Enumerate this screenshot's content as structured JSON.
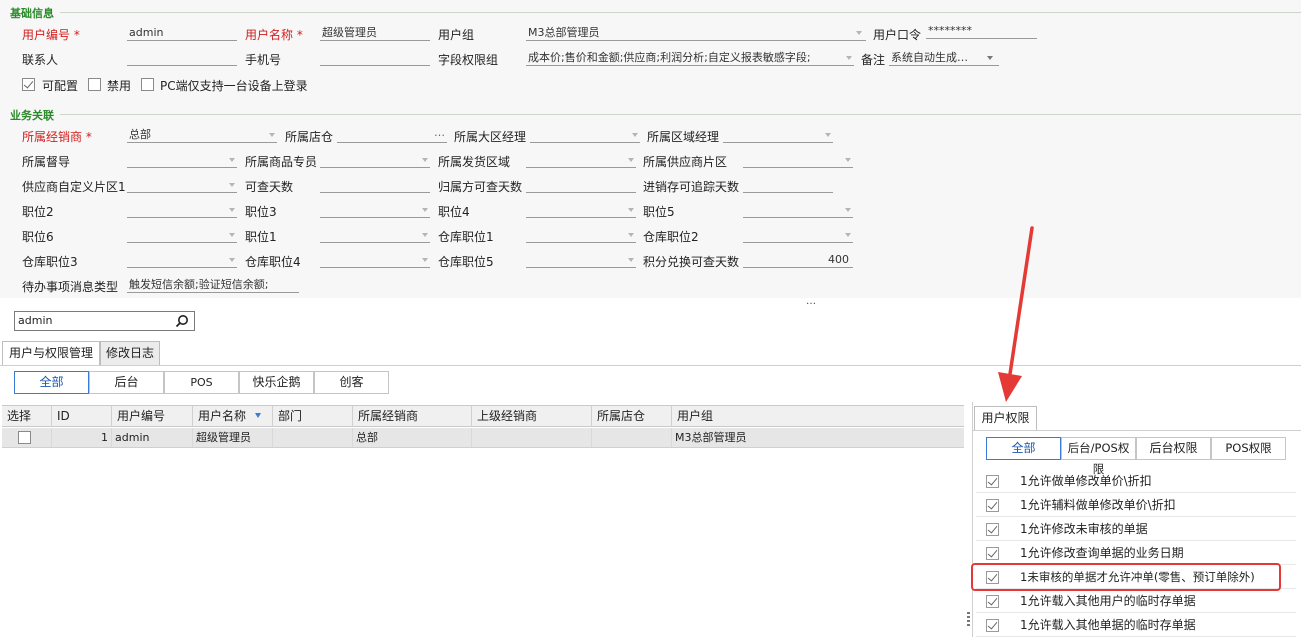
{
  "basic": {
    "title": "基础信息",
    "user_code_label": "用户编号",
    "user_code_value": "admin",
    "user_name_label": "用户名称",
    "user_name_value": "超级管理员",
    "user_group_label": "用户组",
    "user_group_value": "M3总部管理员",
    "password_label": "用户口令",
    "password_value": "********",
    "contact_label": "联系人",
    "phone_label": "手机号",
    "field_perm_label": "字段权限组",
    "field_perm_value": "成本价;售价和金额;供应商;利润分析;自定义报表敏感字段;",
    "remark_label": "备注",
    "remark_value": "系统自动生成…",
    "asterisk": "*",
    "chk_configurable": "可配置",
    "chk_disabled": "禁用",
    "chk_pc_single": "PC端仅支持一台设备上登录"
  },
  "biz": {
    "title": "业务关联",
    "dealer_label": "所属经销商",
    "dealer_value": "总部",
    "store_label": "所属店仓",
    "store_value": "…",
    "region_mgr_label": "所属大区经理",
    "area_mgr_label": "所属区域经理",
    "supervisor_label": "所属督导",
    "goods_label": "所属商品专员",
    "ship_area_label": "所属发货区域",
    "supplier_area_label": "所属供应商片区",
    "supplier_custom_label": "供应商自定义片区1",
    "view_days_label": "可查天数",
    "owner_view_days_label": "归属方可查天数",
    "inv_trace_days_label": "进销存可追踪天数",
    "pos2_label": "职位2",
    "pos3_label": "职位3",
    "pos4_label": "职位4",
    "pos5_label": "职位5",
    "pos6_label": "职位6",
    "pos1_label": "职位1",
    "wh_pos1_label": "仓库职位1",
    "wh_pos2_label": "仓库职位2",
    "wh_pos3_label": "仓库职位3",
    "wh_pos4_label": "仓库职位4",
    "wh_pos5_label": "仓库职位5",
    "points_days_label": "积分兑换可查天数",
    "points_days_value": "400",
    "todo_label": "待办事项消息类型",
    "todo_value": "触发短信余额;验证短信余额;",
    "more": "…"
  },
  "search": {
    "value": "admin"
  },
  "tabs": [
    "用户与权限管理",
    "修改日志"
  ],
  "filters": [
    "全部",
    "后台",
    "POS",
    "快乐企鹅",
    "创客"
  ],
  "grid": {
    "headers": [
      "选择",
      "ID",
      "用户编号",
      "用户名称",
      "部门",
      "所属经销商",
      "上级经销商",
      "所属店仓",
      "用户组"
    ],
    "rows": [
      {
        "id": "1",
        "code": "admin",
        "name": "超级管理员",
        "dept": "",
        "dealer": "总部",
        "parent": "",
        "store": "",
        "group": "M3总部管理员"
      }
    ]
  },
  "perm": {
    "tab": "用户权限",
    "filters": [
      "全部",
      "后台/POS权限",
      "后台权限",
      "POS权限"
    ],
    "items": [
      "1允许做单修改单价\\折扣",
      "1允许辅料做单修改单价\\折扣",
      "1允许修改未审核的单据",
      "1允许修改查询单据的业务日期",
      "1未审核的单据才允许冲单(零售、预订单除外)",
      "1允许载入其他用户的临时存单据",
      "1允许载入其他单据的临时存单据"
    ]
  },
  "colors": {
    "required": "#d21e1e",
    "section": "#2a8a2a",
    "accent": "#3a7bd5",
    "annotation": "#e53935"
  }
}
